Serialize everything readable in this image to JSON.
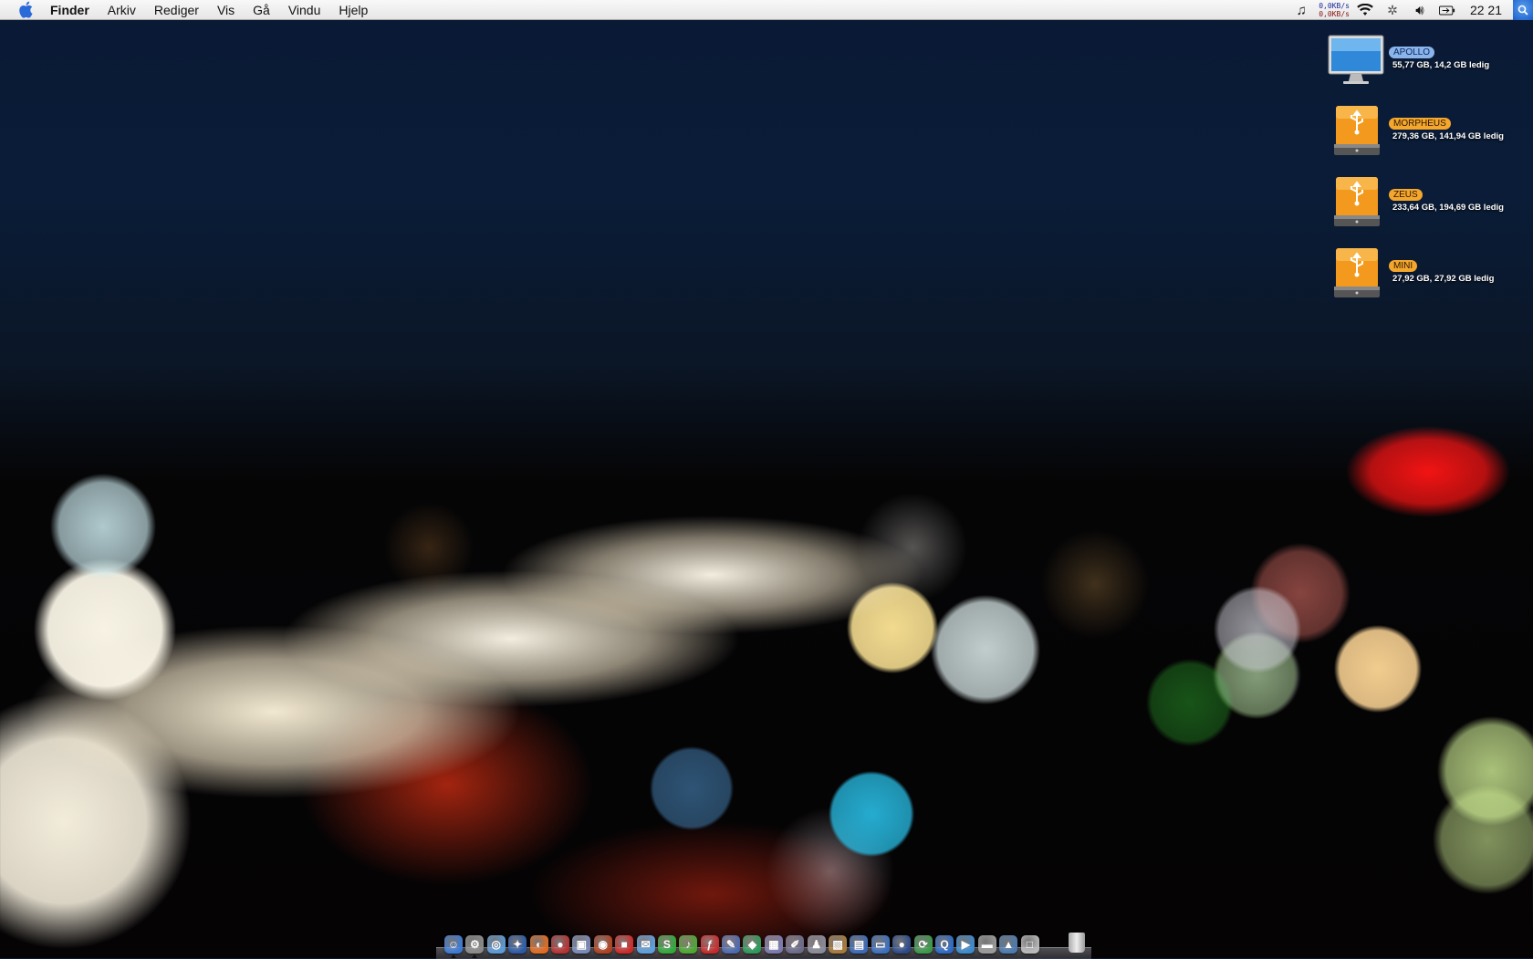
{
  "menubar": {
    "app_name": "Finder",
    "menus": [
      "Arkiv",
      "Rediger",
      "Vis",
      "Gå",
      "Vindu",
      "Hjelp"
    ],
    "network": {
      "up": "0,0KB/s",
      "down": "0,0KB/s"
    },
    "clock": "22 21",
    "status_icons": [
      "music-note-icon",
      "wifi-icon",
      "bluetooth-icon",
      "volume-icon",
      "battery-icon",
      "spotlight-icon"
    ]
  },
  "desktop": {
    "volumes": [
      {
        "name": "APOLLO",
        "info": "55,77 GB, 14,2 GB ledig",
        "icon": "monitor-icon",
        "selected": true
      },
      {
        "name": "MORPHEUS",
        "info": "279,36 GB, 141,94 GB ledig",
        "icon": "usb-drive-icon",
        "selected": false
      },
      {
        "name": "ZEUS",
        "info": "233,64 GB, 194,69 GB ledig",
        "icon": "usb-drive-icon",
        "selected": false
      },
      {
        "name": "MINI",
        "info": "27,92 GB, 27,92 GB ledig",
        "icon": "usb-drive-icon",
        "selected": false
      }
    ],
    "colors": {
      "selected_label": "#8bb5ea",
      "drive_label": "#f4a62d",
      "drive_body": "#f39a1e"
    }
  },
  "dock": {
    "apps": [
      {
        "name": "finder",
        "glyph": "☺",
        "color": "#3b7ad8",
        "running": true
      },
      {
        "name": "system-preferences",
        "glyph": "⚙",
        "color": "#8a8a8a",
        "running": true
      },
      {
        "name": "safari",
        "glyph": "◎",
        "color": "#5a9ad8",
        "running": false
      },
      {
        "name": "dashboard",
        "glyph": "✦",
        "color": "#2a5aa8",
        "running": false
      },
      {
        "name": "firefox",
        "glyph": "◐",
        "color": "#e46a1e",
        "running": false
      },
      {
        "name": "flock",
        "glyph": "●",
        "color": "#b83030",
        "running": false
      },
      {
        "name": "preview",
        "glyph": "▣",
        "color": "#7a8ab8",
        "running": false
      },
      {
        "name": "transmission",
        "glyph": "◉",
        "color": "#b04020",
        "running": false
      },
      {
        "name": "lock",
        "glyph": "■",
        "color": "#d02828",
        "running": false
      },
      {
        "name": "ichat",
        "glyph": "✉",
        "color": "#5aa0e0",
        "running": false
      },
      {
        "name": "skype",
        "glyph": "S",
        "color": "#2eaa3a",
        "running": false
      },
      {
        "name": "itunes",
        "glyph": "♪",
        "color": "#4aa830",
        "running": false
      },
      {
        "name": "flash",
        "glyph": "ƒ",
        "color": "#c82a2a",
        "running": false
      },
      {
        "name": "textedit",
        "glyph": "✎",
        "color": "#4a6ab0",
        "running": false
      },
      {
        "name": "dreamweaver",
        "glyph": "◆",
        "color": "#2a9a5a",
        "running": false
      },
      {
        "name": "package",
        "glyph": "▦",
        "color": "#7a7ab0",
        "running": false
      },
      {
        "name": "script-editor",
        "glyph": "✐",
        "color": "#6a6a8a",
        "running": false
      },
      {
        "name": "automator",
        "glyph": "♟",
        "color": "#8a8a9a",
        "running": false
      },
      {
        "name": "iphoto",
        "glyph": "▧",
        "color": "#a87a3a",
        "running": false
      },
      {
        "name": "calendar",
        "glyph": "▤",
        "color": "#3a6ab8",
        "running": false
      },
      {
        "name": "address-book",
        "glyph": "▭",
        "color": "#3a70c0",
        "running": false
      },
      {
        "name": "cyberduck",
        "glyph": "●",
        "color": "#2a4a8a",
        "running": false
      },
      {
        "name": "sync",
        "glyph": "⟳",
        "color": "#3a9a4a",
        "running": false
      },
      {
        "name": "quicktime",
        "glyph": "Q",
        "color": "#2a6ac8",
        "running": false
      },
      {
        "name": "media-player",
        "glyph": "▶",
        "color": "#3a8ad0",
        "running": false
      },
      {
        "name": "hard-disk",
        "glyph": "▬",
        "color": "#9a9a9a",
        "running": false
      },
      {
        "name": "activity-monitor",
        "glyph": "▲",
        "color": "#4a7ab0",
        "running": false
      },
      {
        "name": "boot-camp",
        "glyph": "□",
        "color": "#bababa",
        "running": false
      }
    ]
  }
}
